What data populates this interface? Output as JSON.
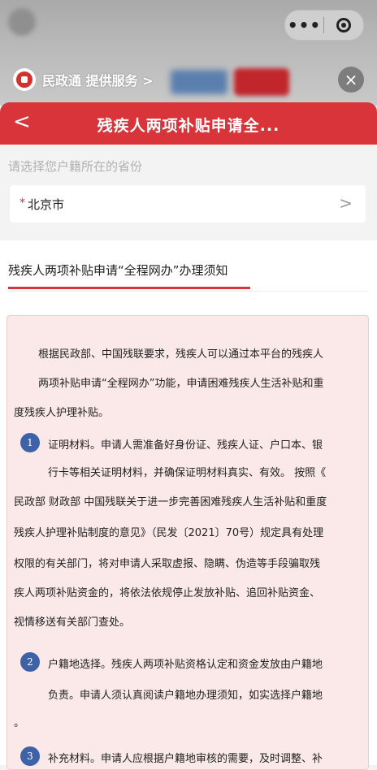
{
  "miniprogram": {
    "more_glyph": "•••",
    "service_text": "民政通 提供服务 >",
    "close_glyph": "×"
  },
  "header": {
    "back_glyph": "<",
    "title": "残疾人两项补贴申请全..."
  },
  "province": {
    "label": "请选择您户籍所在的省份",
    "required_mark": "*",
    "value": "北京市",
    "arrow_glyph": ">"
  },
  "notice": {
    "title": "残疾人两项补贴申请“全程网办”办理须知",
    "intro_lines": [
      "根据民政部、中国残联要求，残疾人可以通过本平台的残疾人",
      "两项补贴申请“全程网办”功能，申请困难残疾人生活补贴和重",
      "度残疾人护理补贴。"
    ],
    "items": [
      {
        "number": "1",
        "lines": [
          "证明材料。申请人需准备好身份证、残疾人证、户口本、银",
          "行卡等相关证明材料，并确保证明材料真实、有效。 按照《",
          "民政部 财政部 中国残联关于进一步完善困难残疾人生活补贴和重度",
          "残疾人护理补贴制度的意见》（民发〔2021〕70号）规定具有处理",
          "权限的有关部门，将对申请人采取虚报、隐瞒、伪造等手段骗取残",
          "疾人两项补贴资金的，将依法依规停止发放补贴、追回补贴资金、",
          "视情移送有关部门查处。"
        ]
      },
      {
        "number": "2",
        "lines": [
          "户籍地选择。残疾人两项补贴资格认定和资金发放由户籍地",
          "负责。申请人须认真阅读户籍地办理须知，如实选择户籍地",
          "。"
        ]
      },
      {
        "number": "3",
        "lines": [
          "补充材料。申请人应根据户籍地审核的需要，及时调整、补"
        ]
      }
    ]
  },
  "colors": {
    "accent_red": "#d8343a",
    "number_badge_blue": "#3d62a7",
    "notice_box_bg": "#fbe9e9"
  },
  "icons": [
    "more-dots-icon",
    "target-icon",
    "service-logo-icon",
    "close-icon",
    "back-arrow-icon",
    "chevron-right-icon"
  ]
}
